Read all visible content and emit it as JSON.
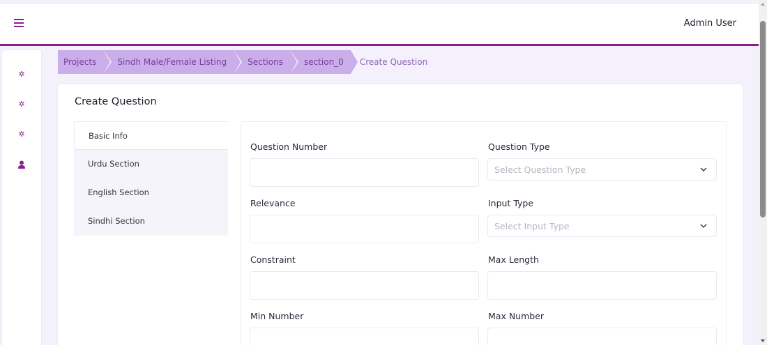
{
  "header": {
    "menu_icon": "hamburger-icon",
    "user_name": "Admin User"
  },
  "sidebar": {
    "items": [
      {
        "icon": "gear-icon"
      },
      {
        "icon": "gear-icon"
      },
      {
        "icon": "gear-icon"
      },
      {
        "icon": "person-icon"
      }
    ]
  },
  "breadcrumb": {
    "items": [
      "Projects",
      "Sindh Male/Female Listing",
      "Sections",
      "section_0"
    ],
    "current": "Create Question"
  },
  "card": {
    "title": "Create Question",
    "tabs": [
      "Basic Info",
      "Urdu Section",
      "English Section",
      "Sindhi Section"
    ],
    "active_tab": "Basic Info"
  },
  "form": {
    "question_number": {
      "label": "Question Number",
      "value": ""
    },
    "question_type": {
      "label": "Question Type",
      "placeholder": "Select Question Type"
    },
    "relevance": {
      "label": "Relevance",
      "value": ""
    },
    "input_type": {
      "label": "Input Type",
      "placeholder": "Select Input Type"
    },
    "constraint": {
      "label": "Constraint",
      "value": ""
    },
    "max_length": {
      "label": "Max Length",
      "value": ""
    },
    "min_number": {
      "label": "Min Number",
      "value": ""
    },
    "max_number": {
      "label": "Max Number",
      "value": ""
    }
  },
  "colors": {
    "brand": "#8a1f8a",
    "breadcrumb_bg": "#c9aeea",
    "page_bg": "#f4f1fc"
  }
}
